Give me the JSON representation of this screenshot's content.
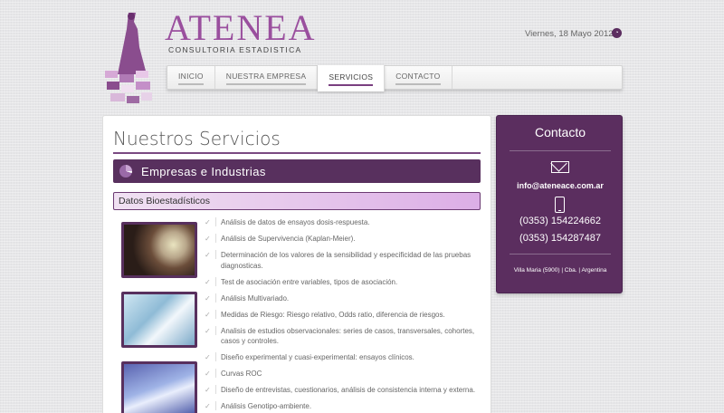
{
  "logo": {
    "title": "ATENEA",
    "subtitle": "CONSULTORIA ESTADISTICA"
  },
  "header": {
    "date": "Viernes, 18 Mayo 2012"
  },
  "nav": {
    "items": [
      "INICIO",
      "NUESTRA EMPRESA",
      "SERVICIOS",
      "CONTACTO"
    ],
    "active": "SERVICIOS"
  },
  "main": {
    "title": "Nuestros Servicios",
    "section": "Empresas e Industrias",
    "subsection": "Datos Bioestadísticos",
    "items": [
      "Análisis de datos de ensayos dosis-respuesta.",
      "Análisis de Supervivencia (Kaplan-Meier).",
      "Determinación de los valores de la sensibilidad y especificidad de las pruebas diagnosticas.",
      "Test de asociación entre variables, tipos de asociación.",
      "Análisis Multivariado.",
      "Medidas de Riesgo: Riesgo relativo, Odds ratio, diferencia de riesgos.",
      "Analisis de estudios observacionales: series de casos, transversales, cohortes, casos y controles.",
      "Diseño experimental y cuasi-experimental: ensayos clínicos.",
      "Curvas ROC",
      "Diseño de entrevistas, cuestionarios, análisis de consistencia interna y externa.",
      "Análisis Genotipo-ambiente."
    ]
  },
  "sidebar": {
    "title": "Contacto",
    "email": "info@ateneace.com.ar",
    "phone1": "(0353) 154224662",
    "phone2": "(0353) 154287487",
    "address": "Villa Maria (5900) | Cba. | Argentina"
  },
  "colors": {
    "primary": "#58305e",
    "accent": "#9a4f9e"
  }
}
